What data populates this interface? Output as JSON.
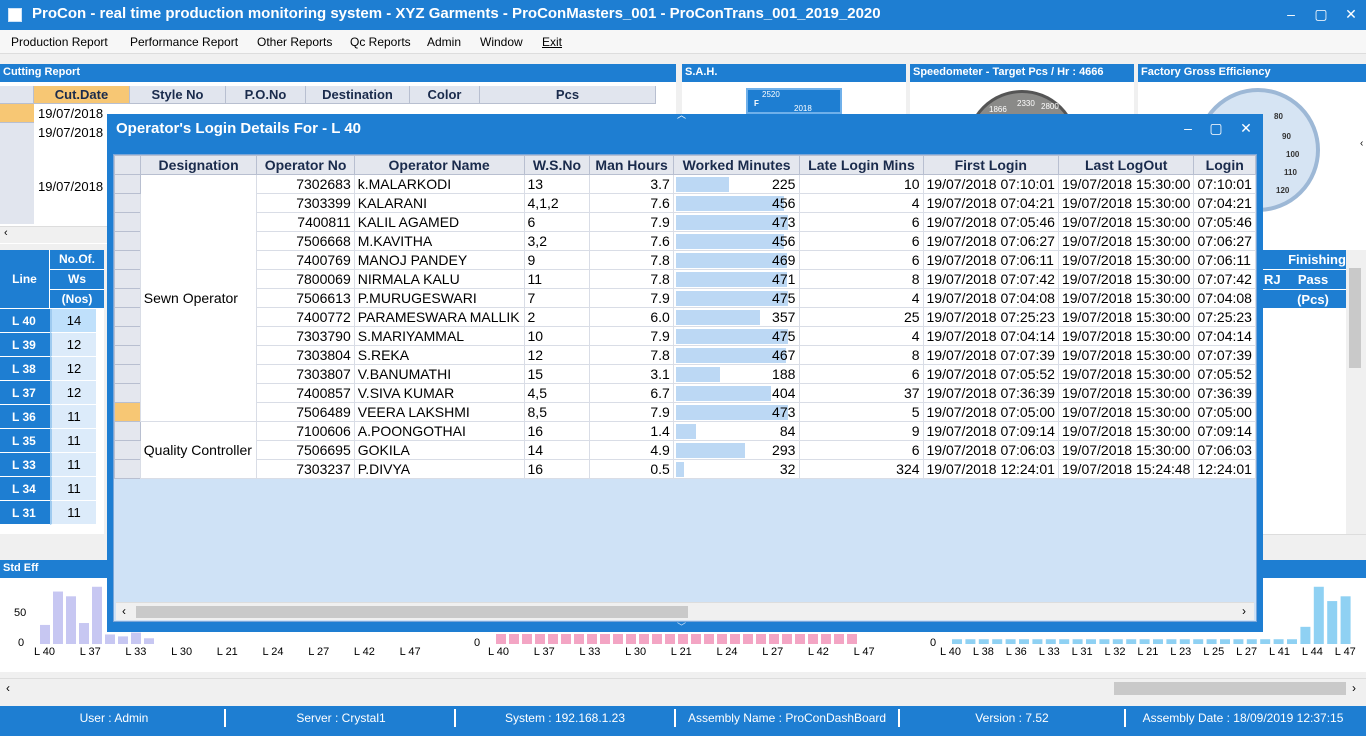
{
  "window": {
    "title": "ProCon - real time production monitoring system - XYZ Garments - ProConMasters_001 - ProConTrans_001_2019_2020",
    "min": "‒",
    "max": "▢",
    "close": "✕"
  },
  "menu": [
    "Production Report",
    "Performance Report",
    "Other Reports",
    "Qc Reports",
    "Admin",
    "Window",
    "Exit"
  ],
  "cutting": {
    "title": "Cutting Report",
    "headers": [
      "Cut.Date",
      "Style No",
      "P.O.No",
      "Destination",
      "Color",
      "Pcs"
    ],
    "dates": [
      "19/07/2018",
      "19/07/2018",
      "",
      "",
      "19/07/2018"
    ]
  },
  "sah": {
    "title": "S.A.H.",
    "gauge_top": "2520",
    "gauge_val": "2018",
    "gauge_left": "F"
  },
  "speed": {
    "title": "Speedometer - Target Pcs / Hr : 4666",
    "readout": "2330",
    "t1": "1866",
    "t2": "2800"
  },
  "factory": {
    "title": "Factory Gross Efficiency",
    "ticks": [
      "80",
      "90",
      "100",
      "110",
      "120"
    ]
  },
  "lines": {
    "headers": {
      "line": "Line",
      "ws1": "No.Of.",
      "ws2": "Ws",
      "ws3": "(Nos)"
    },
    "rows": [
      {
        "line": "L 40",
        "ws": "14"
      },
      {
        "line": "L 39",
        "ws": "12"
      },
      {
        "line": "L 38",
        "ws": "12"
      },
      {
        "line": "L 37",
        "ws": "12"
      },
      {
        "line": "L 36",
        "ws": "11"
      },
      {
        "line": "L 35",
        "ws": "11"
      },
      {
        "line": "L 33",
        "ws": "11"
      },
      {
        "line": "L 34",
        "ws": "11"
      },
      {
        "line": "L 31",
        "ws": "11"
      }
    ]
  },
  "finishing": {
    "h1": "Finishing",
    "h2": "Pass",
    "h3": "(Pcs)",
    "rj": "RJ"
  },
  "std_eff": {
    "title": "Std Eff",
    "y_top": "50",
    "y_zero": "0",
    "x": [
      "L 40",
      "L 37",
      "L 33",
      "L 30",
      "L 21",
      "L 24",
      "L 27",
      "L 42",
      "L 47"
    ],
    "values": [
      20,
      55,
      50,
      22,
      60,
      10,
      8,
      12,
      6
    ]
  },
  "chart2": {
    "y_zero": "0",
    "x": [
      "L 40",
      "L 37",
      "L 33",
      "L 30",
      "L 21",
      "L 24",
      "L 27",
      "L 42",
      "L 47"
    ]
  },
  "chart3": {
    "y_zero": "0",
    "x": [
      "L 40",
      "L 38",
      "L 36",
      "L 33",
      "L 31",
      "L 32",
      "L 21",
      "L 23",
      "L 25",
      "L 27",
      "L 41",
      "L 44",
      "L 47"
    ],
    "values": [
      5,
      5,
      5,
      5,
      5,
      5,
      5,
      5,
      5,
      5,
      18,
      60,
      45,
      50
    ]
  },
  "dialog": {
    "title": "Operator's Login Details For - L 40",
    "columns": [
      "Designation",
      "Operator No",
      "Operator Name",
      "W.S.No",
      "Man Hours",
      "Worked Minutes",
      "Late Login Mins",
      "First Login",
      "Last LogOut",
      "Login"
    ],
    "max_minutes": 500,
    "groups": [
      {
        "designation": "Sewn Operator",
        "rows": [
          {
            "no": "7302683",
            "name": "k.MALARKODI",
            "ws": "13",
            "hours": "3.7",
            "minutes": 225,
            "late": "10",
            "first": "19/07/2018 07:10:01",
            "last": "19/07/2018 15:30:00",
            "login": "07:10:01"
          },
          {
            "no": "7303399",
            "name": "KALARANI",
            "ws": "4,1,2",
            "hours": "7.6",
            "minutes": 456,
            "late": "4",
            "first": "19/07/2018 07:04:21",
            "last": "19/07/2018 15:30:00",
            "login": "07:04:21"
          },
          {
            "no": "7400811",
            "name": "KALIL AGAMED",
            "ws": "6",
            "hours": "7.9",
            "minutes": 473,
            "late": "6",
            "first": "19/07/2018 07:05:46",
            "last": "19/07/2018 15:30:00",
            "login": "07:05:46"
          },
          {
            "no": "7506668",
            "name": "M.KAVITHA",
            "ws": "3,2",
            "hours": "7.6",
            "minutes": 456,
            "late": "6",
            "first": "19/07/2018 07:06:27",
            "last": "19/07/2018 15:30:00",
            "login": "07:06:27"
          },
          {
            "no": "7400769",
            "name": "MANOJ PANDEY",
            "ws": "9",
            "hours": "7.8",
            "minutes": 469,
            "late": "6",
            "first": "19/07/2018 07:06:11",
            "last": "19/07/2018 15:30:00",
            "login": "07:06:11"
          },
          {
            "no": "7800069",
            "name": "NIRMALA KALU",
            "ws": "11",
            "hours": "7.8",
            "minutes": 471,
            "late": "8",
            "first": "19/07/2018 07:07:42",
            "last": "19/07/2018 15:30:00",
            "login": "07:07:42"
          },
          {
            "no": "7506613",
            "name": "P.MURUGESWARI",
            "ws": "7",
            "hours": "7.9",
            "minutes": 475,
            "late": "4",
            "first": "19/07/2018 07:04:08",
            "last": "19/07/2018 15:30:00",
            "login": "07:04:08"
          },
          {
            "no": "7400772",
            "name": "PARAMESWARA MALLIK",
            "ws": "2",
            "hours": "6.0",
            "minutes": 357,
            "late": "25",
            "first": "19/07/2018 07:25:23",
            "last": "19/07/2018 15:30:00",
            "login": "07:25:23"
          },
          {
            "no": "7303790",
            "name": "S.MARIYAMMAL",
            "ws": "10",
            "hours": "7.9",
            "minutes": 475,
            "late": "4",
            "first": "19/07/2018 07:04:14",
            "last": "19/07/2018 15:30:00",
            "login": "07:04:14"
          },
          {
            "no": "7303804",
            "name": "S.REKA",
            "ws": "12",
            "hours": "7.8",
            "minutes": 467,
            "late": "8",
            "first": "19/07/2018 07:07:39",
            "last": "19/07/2018 15:30:00",
            "login": "07:07:39"
          },
          {
            "no": "7303807",
            "name": "V.BANUMATHI",
            "ws": "15",
            "hours": "3.1",
            "minutes": 188,
            "late": "6",
            "first": "19/07/2018 07:05:52",
            "last": "19/07/2018 15:30:00",
            "login": "07:05:52"
          },
          {
            "no": "7400857",
            "name": "V.SIVA KUMAR",
            "ws": "4,5",
            "hours": "6.7",
            "minutes": 404,
            "late": "37",
            "first": "19/07/2018 07:36:39",
            "last": "19/07/2018 15:30:00",
            "login": "07:36:39"
          },
          {
            "no": "7506489",
            "name": "VEERA LAKSHMI",
            "ws": "8,5",
            "hours": "7.9",
            "minutes": 473,
            "late": "5",
            "first": "19/07/2018 07:05:00",
            "last": "19/07/2018 15:30:00",
            "login": "07:05:00"
          }
        ]
      },
      {
        "designation": "Quality Controller",
        "rows": [
          {
            "no": "7100606",
            "name": "A.POONGOTHAI",
            "ws": "16",
            "hours": "1.4",
            "minutes": 84,
            "late": "9",
            "first": "19/07/2018 07:09:14",
            "last": "19/07/2018 15:30:00",
            "login": "07:09:14"
          },
          {
            "no": "7506695",
            "name": "GOKILA",
            "ws": "14",
            "hours": "4.9",
            "minutes": 293,
            "late": "6",
            "first": "19/07/2018 07:06:03",
            "last": "19/07/2018 15:30:00",
            "login": "07:06:03"
          },
          {
            "no": "7303237",
            "name": "P.DIVYA",
            "ws": "16",
            "hours": "0.5",
            "minutes": 32,
            "late": "324",
            "first": "19/07/2018 12:24:01",
            "last": "19/07/2018 15:24:48",
            "login": "12:24:01"
          }
        ]
      }
    ],
    "selected_row": 12
  },
  "status": {
    "user": "User : Admin",
    "server": "Server : Crystal1",
    "system": "System : 192.168.1.23",
    "assembly": "Assembly Name : ProConDashBoard",
    "version": "Version : 7.52",
    "date": "Assembly Date : 18/09/2019 12:37:15"
  },
  "colors": {
    "accent": "#1e7ed2",
    "bar": "#bcd8f4",
    "chart_purple": "#c7c7f2",
    "chart_pink": "#f3a5c4",
    "chart_blue": "#8fd1f3"
  }
}
